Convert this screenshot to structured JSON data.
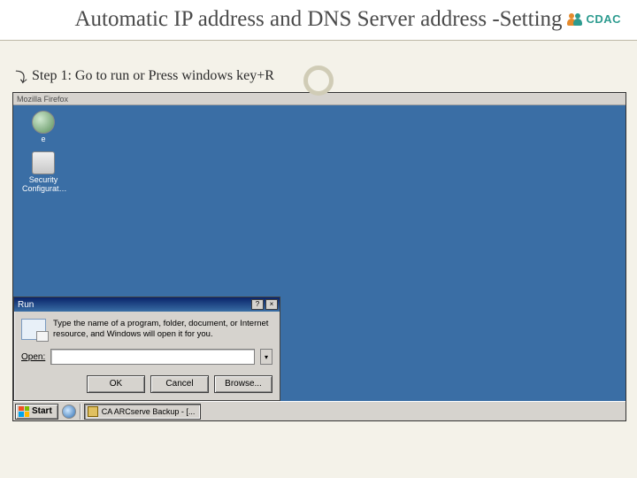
{
  "title_line": "Automatic IP address and DNS Server address -Setting",
  "logo_text": "CDAC",
  "bullet": "Step 1: Go to run or Press windows key+R",
  "screenshot": {
    "window_title": "Mozilla Firefox",
    "desktop_icons": [
      {
        "label": "e"
      },
      {
        "label": "Security Configurat…"
      }
    ],
    "run_dialog": {
      "title": "Run",
      "description": "Type the name of a program, folder, document, or Internet resource, and Windows will open it for you.",
      "open_label": "Open:",
      "buttons": {
        "ok": "OK",
        "cancel": "Cancel",
        "browse": "Browse..."
      }
    },
    "taskbar": {
      "start": "Start",
      "task_button": "CA ARCserve Backup - [..."
    }
  }
}
